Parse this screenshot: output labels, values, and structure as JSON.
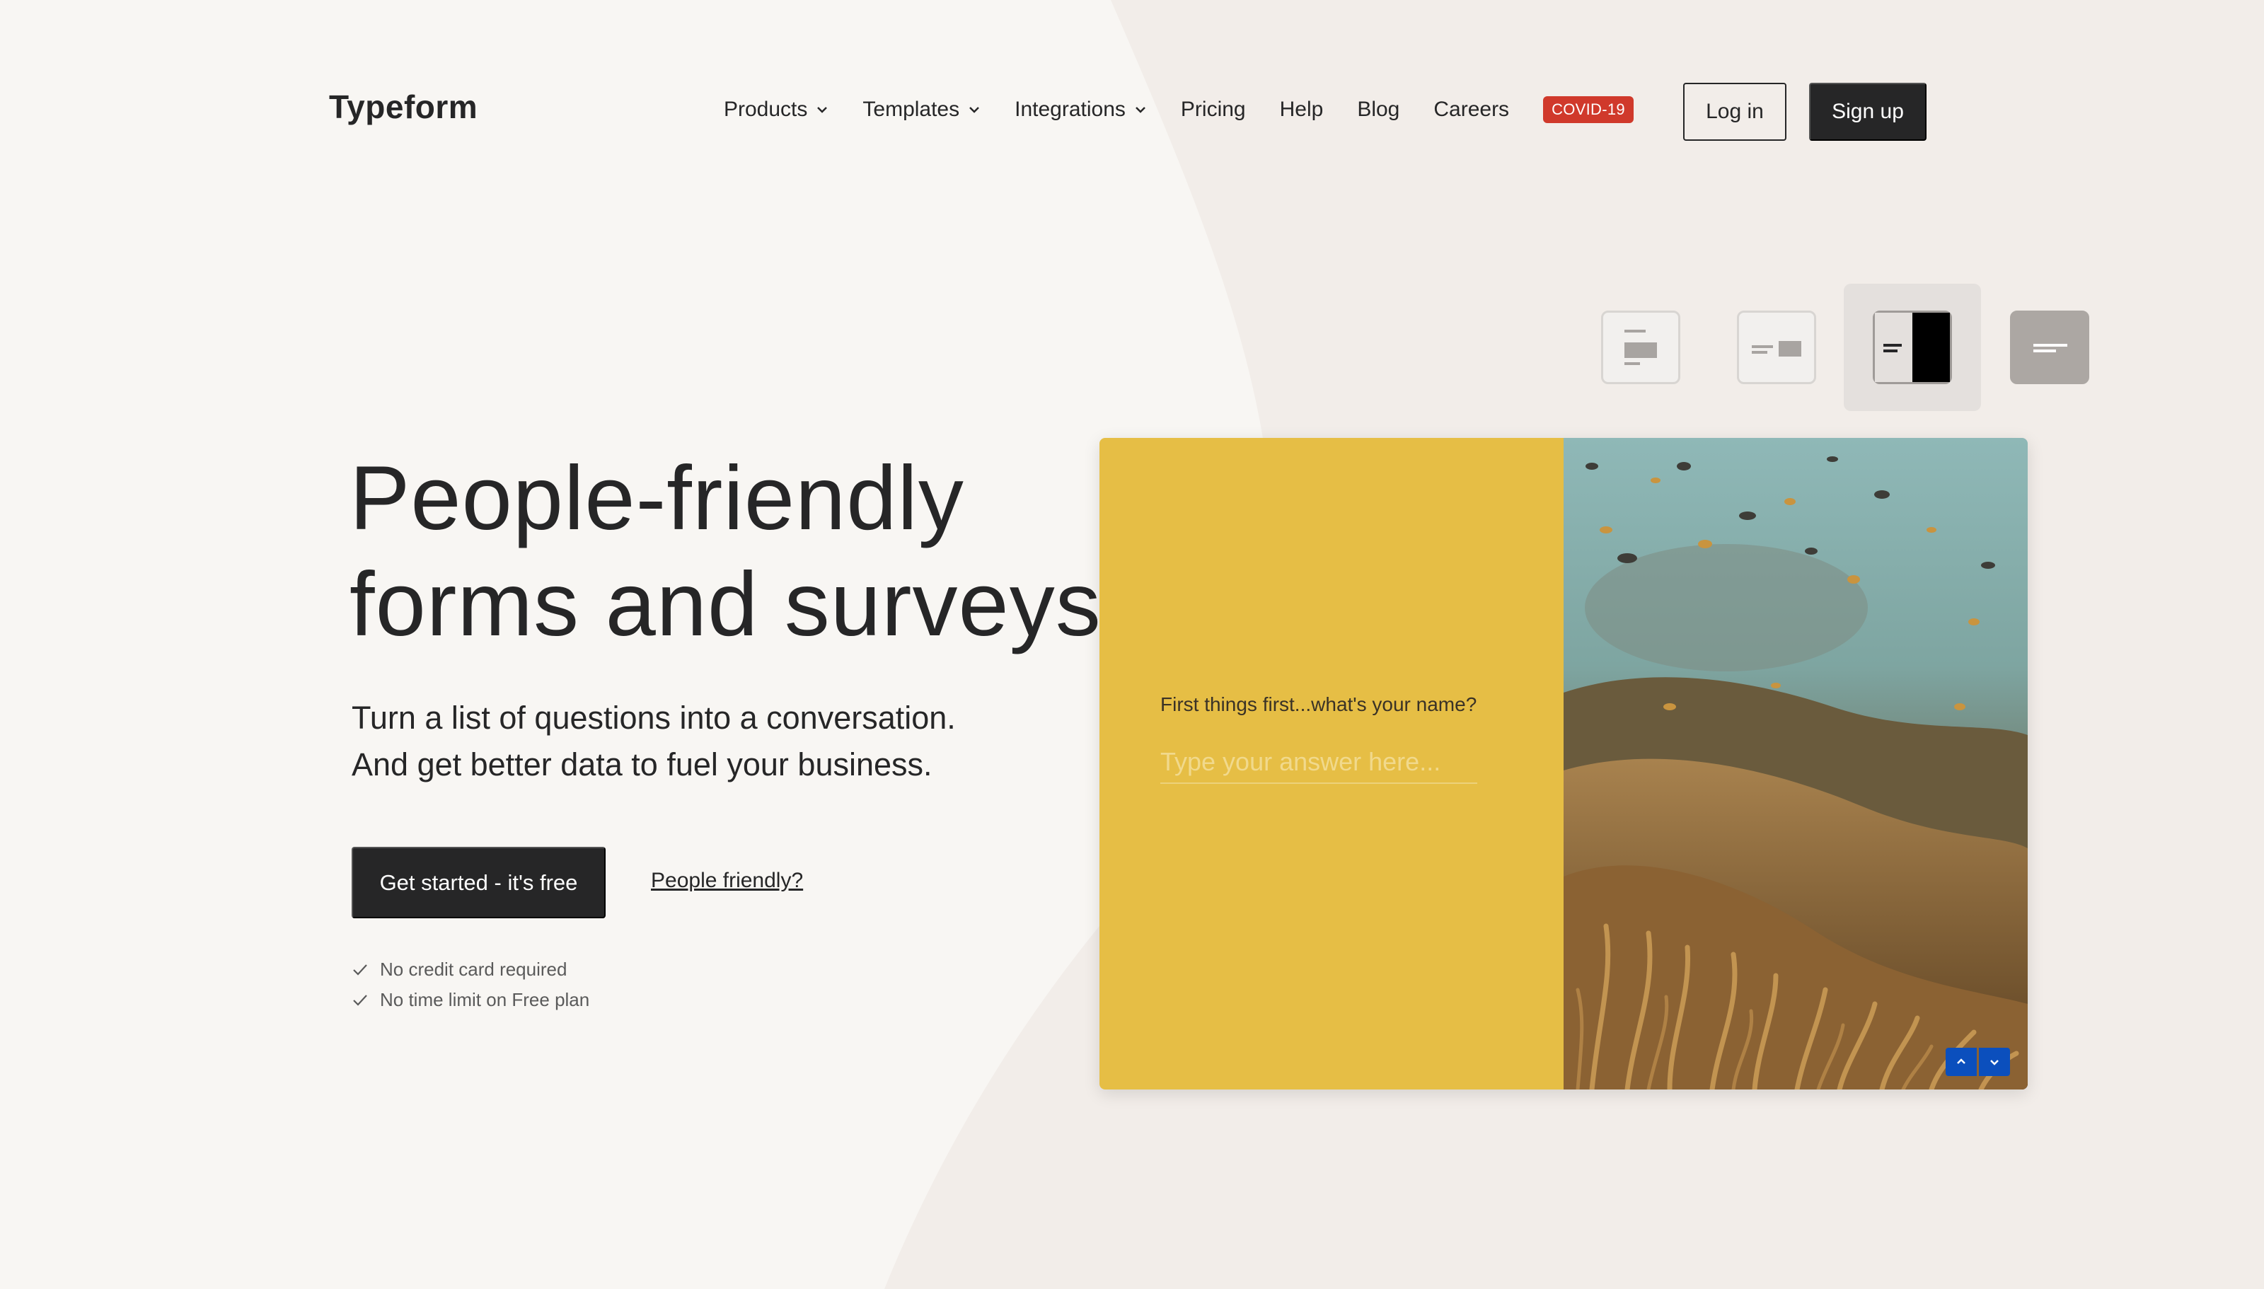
{
  "header": {
    "logo": "Typeform",
    "nav": [
      {
        "label": "Products",
        "dropdown": true
      },
      {
        "label": "Templates",
        "dropdown": true
      },
      {
        "label": "Integrations",
        "dropdown": true
      },
      {
        "label": "Pricing",
        "dropdown": false
      },
      {
        "label": "Help",
        "dropdown": false
      },
      {
        "label": "Blog",
        "dropdown": false
      },
      {
        "label": "Careers",
        "dropdown": false
      }
    ],
    "badge": "COVID-19",
    "login_label": "Log in",
    "signup_label": "Sign up"
  },
  "hero": {
    "title_line1": "People-friendly",
    "title_line2": "forms and surveys",
    "subtitle_line1": "Turn a list of questions into a conversation.",
    "subtitle_line2": "And get better data to fuel your business.",
    "cta_label": "Get started - it's free",
    "secondary_link": "People friendly?",
    "checks": [
      "No credit card required",
      "No time limit on Free plan"
    ]
  },
  "layout_switcher": {
    "options": [
      "stack-layout-icon",
      "split-small-image-icon",
      "split-half-icon",
      "float-left-icon"
    ],
    "active_index": 2
  },
  "form_preview": {
    "question": "First things first...what's your name?",
    "answer_placeholder": "Type your answer here...",
    "panel_color": "#e6be45",
    "nav_color": "#0b4fbd"
  },
  "colors": {
    "background": "#f8f6f3",
    "shape": "#f2ede9",
    "dark": "#262627",
    "badge": "#d0392b"
  }
}
